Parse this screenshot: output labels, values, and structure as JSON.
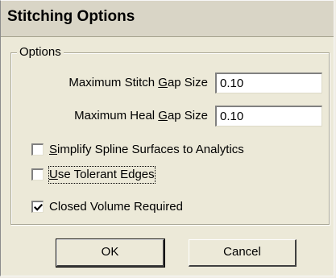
{
  "window": {
    "title": "Stitching Options"
  },
  "options_group": {
    "legend": "Options",
    "stitch_gap": {
      "label_pre": "Maximum Stitch ",
      "label_accel": "G",
      "label_post": "ap Size",
      "value": "0.10"
    },
    "heal_gap": {
      "label_pre": "Maximum Heal ",
      "label_accel": "G",
      "label_post": "ap Size",
      "value": "0.10"
    },
    "checkboxes": [
      {
        "accel": "S",
        "rest": "implify Spline Surfaces to Analytics",
        "checked": false
      },
      {
        "accel": "U",
        "rest": "se Tolerant Edges",
        "checked": false
      },
      {
        "accel": "",
        "rest": "Closed Volume Required",
        "checked": true
      }
    ]
  },
  "buttons": {
    "ok_label": "OK",
    "cancel_label": "Cancel"
  }
}
